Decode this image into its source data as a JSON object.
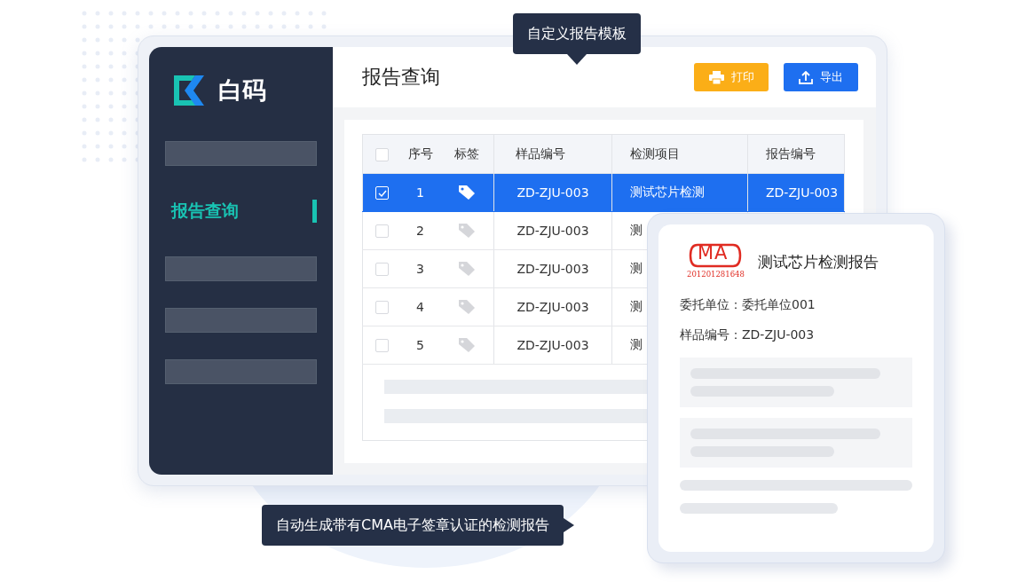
{
  "tooltips": [
    {
      "text": "自定义报告模板",
      "kind": "below"
    },
    {
      "text": "自动生成带有CMA电子签章认证的检测报告",
      "kind": "side"
    }
  ],
  "sidebar": {
    "logo": "白码",
    "items": [
      {
        "kind": "placeholder",
        "selected": false
      },
      {
        "kind": "link",
        "label": "报告查询",
        "selected": true
      },
      {
        "kind": "placeholder",
        "selected": false
      },
      {
        "kind": "placeholder",
        "selected": false
      },
      {
        "kind": "placeholder",
        "selected": false
      }
    ]
  },
  "header": {
    "title": "报告查询",
    "buttons": [
      {
        "kind": "print",
        "label": "打印"
      },
      {
        "kind": "export",
        "label": "导出"
      }
    ]
  },
  "table": {
    "all_checked": false,
    "columns": [
      "序号",
      "标签",
      "样品编号",
      "检测项目",
      "报告编号"
    ],
    "rows": [
      {
        "selected": true,
        "checked": true,
        "no": "1",
        "sample": "ZD-ZJU-003",
        "item": "测试芯片检测",
        "report": "ZD-ZJU-003"
      },
      {
        "selected": false,
        "checked": false,
        "no": "2",
        "sample": "ZD-ZJU-003",
        "item": "测"
      },
      {
        "selected": false,
        "checked": false,
        "no": "3",
        "sample": "ZD-ZJU-003",
        "item": "测"
      },
      {
        "selected": false,
        "checked": false,
        "no": "4",
        "sample": "ZD-ZJU-003",
        "item": "测"
      },
      {
        "selected": false,
        "checked": false,
        "no": "5",
        "sample": "ZD-ZJU-003",
        "item": "测"
      }
    ]
  },
  "report": {
    "seal_text": "MA",
    "seal_number": "201201281648",
    "title": "测试芯片检测报告",
    "fields": [
      {
        "label": "委托单位：",
        "value": "委托单位001"
      },
      {
        "label": "样品编号：",
        "value": "ZD-ZJU-003"
      }
    ]
  }
}
